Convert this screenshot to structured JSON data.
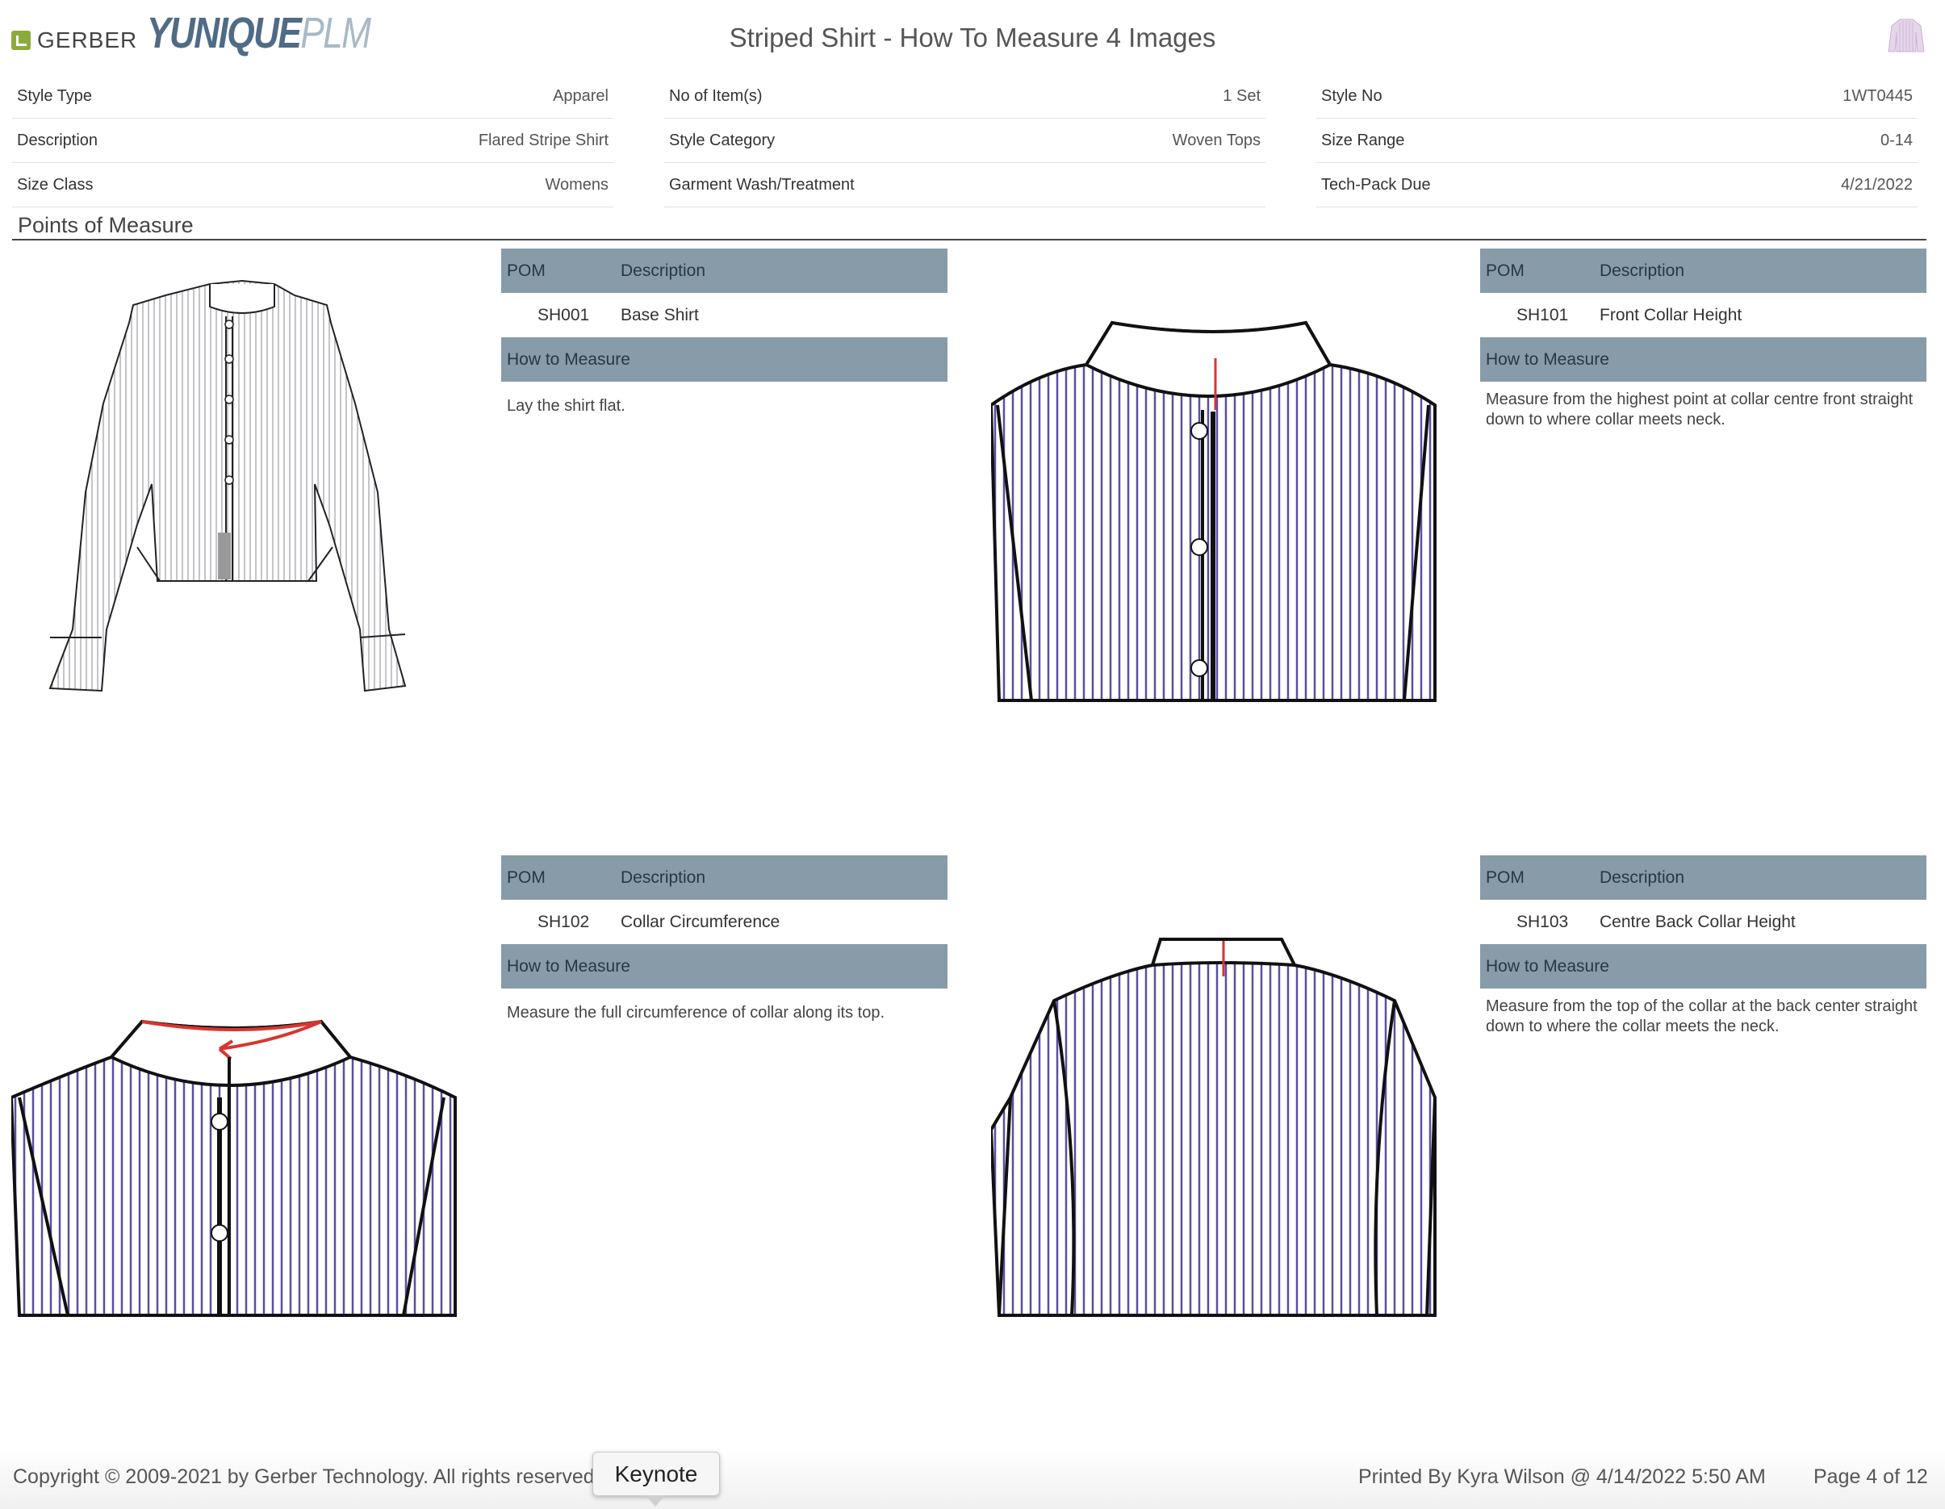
{
  "header": {
    "logo_gerber": "GERBER",
    "logo_yunique": "YUNIQUE",
    "logo_plm": "PLM",
    "title": "Striped Shirt - How To Measure 4 Images"
  },
  "info": {
    "col1": [
      {
        "label": "Style Type",
        "value": "Apparel"
      },
      {
        "label": "Description",
        "value": "Flared Stripe Shirt"
      },
      {
        "label": "Size Class",
        "value": "Womens"
      }
    ],
    "col2": [
      {
        "label": "No of Item(s)",
        "value": "1 Set"
      },
      {
        "label": "Style Category",
        "value": "Woven Tops"
      },
      {
        "label": "Garment Wash/Treatment",
        "value": ""
      }
    ],
    "col3": [
      {
        "label": "Style No",
        "value": "1WT0445"
      },
      {
        "label": "Size Range",
        "value": "0-14"
      },
      {
        "label": "Tech-Pack Due",
        "value": "4/21/2022"
      }
    ]
  },
  "section_title": "Points of Measure",
  "poms": [
    {
      "col_pom": "POM",
      "col_desc": "Description",
      "code": "SH001",
      "description": "Base Shirt",
      "htm_label": "How to Measure",
      "how_to_measure": "Lay the shirt flat."
    },
    {
      "col_pom": "POM",
      "col_desc": "Description",
      "code": "SH101",
      "description": "Front Collar Height",
      "htm_label": "How to Measure",
      "how_to_measure": "Measure from the highest point at collar centre front straight down to where collar meets neck."
    },
    {
      "col_pom": "POM",
      "col_desc": "Description",
      "code": "SH102",
      "description": "Collar Circumference",
      "htm_label": "How to Measure",
      "how_to_measure": "Measure the full circumference of collar along its top."
    },
    {
      "col_pom": "POM",
      "col_desc": "Description",
      "code": "SH103",
      "description": "Centre Back Collar Height",
      "htm_label": "How to Measure",
      "how_to_measure": "Measure from the top of the collar at the back center straight down to where the collar meets the neck."
    }
  ],
  "footer": {
    "copyright": "Copyright © 2009-2021 by Gerber Technology. All rights reserved.",
    "printed": "Printed By Kyra Wilson @ 4/14/2022 5:50 AM",
    "page": "Page 4 of 12",
    "tooltip": "Keynote"
  },
  "colors": {
    "table_header": "#879ba8",
    "stripe": "#5b4ea0",
    "measure_line": "#d9352f",
    "logo_green": "#8bab3c"
  }
}
